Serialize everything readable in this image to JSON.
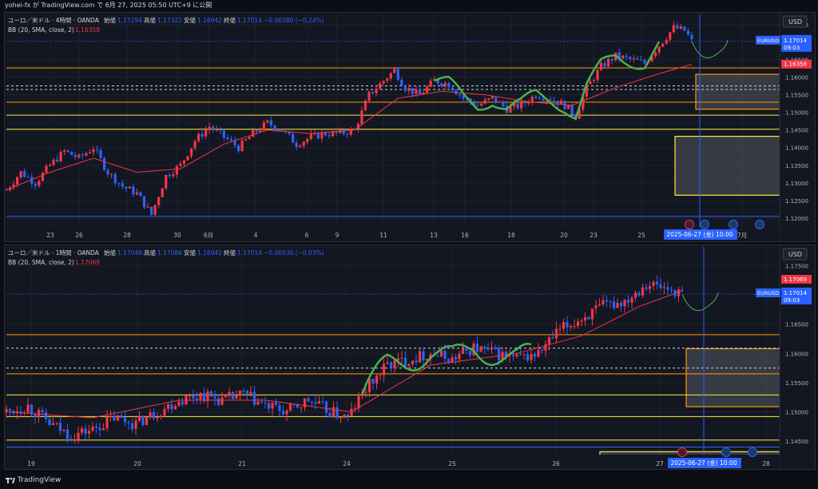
{
  "header": {
    "text": "yohei-fx が TradingView.com で 6月 27, 2025 05:50 UTC+9 に公開"
  },
  "footer": {
    "brand": "TradingView"
  },
  "colors": {
    "bull": "#f23645",
    "bear": "#2962ff",
    "bb": "#f23645",
    "bg": "#131722",
    "grid": "#1e222d",
    "accent": "#2962ff",
    "yellow": "#ffeb3b",
    "orange": "#ff9800"
  },
  "panels": [
    {
      "legend1": "ユーロ／米ドル · 4時間 · OANDA",
      "ohlc_labels": [
        "始値",
        "高値",
        "安値",
        "終値"
      ],
      "ohlc_values": [
        "1.17294",
        "1.17322",
        "1.16942",
        "1.17014"
      ],
      "change": "−0.00280 (−0.24%)",
      "legend2": "BB (20, SMA, close, 2)",
      "bb_value": "1.16358",
      "currency": "USD",
      "symbol": "EURUSD",
      "price_tag": "1.17014",
      "countdown": "09:03",
      "bb_tag": "1.16358",
      "date_tag": "2025-06-27 (金)  10:00",
      "x_labels": [
        "23",
        "26",
        "28",
        "30",
        "6月",
        "4",
        "6",
        "9",
        "11",
        "13",
        "16",
        "18",
        "20",
        "23",
        "25",
        "7月"
      ],
      "y_labels": [
        "1.17500",
        "1.16500",
        "1.16000",
        "1.15500",
        "1.15000",
        "1.14500",
        "1.14000",
        "1.13500",
        "1.13000",
        "1.12500",
        "1.12000"
      ]
    },
    {
      "legend1": "ユーロ／米ドル · 1時間 · OANDA",
      "ohlc_labels": [
        "始値",
        "高値",
        "安値",
        "終値"
      ],
      "ohlc_values": [
        "1.17046",
        "1.17086",
        "1.16942",
        "1.17014"
      ],
      "change": "−0.00030 (−0.03%)",
      "legend2": "BB (20, SMA, close, 2)",
      "bb_value": "1.17069",
      "currency": "USD",
      "symbol": "EURUSD",
      "price_tag": "1.17014",
      "countdown": "09:03",
      "bb_tag": "1.17069",
      "date_tag": "2025-06-27 (金)  10:00",
      "x_labels": [
        "19",
        "20",
        "21",
        "24",
        "25",
        "26",
        "27",
        "28"
      ],
      "y_labels": [
        "1.17500",
        "1.16500",
        "1.16000",
        "1.15500",
        "1.15000",
        "1.14500"
      ]
    }
  ],
  "chart_data": [
    {
      "type": "candlestick",
      "title": "ユーロ／米ドル · 4時間 · OANDA",
      "y_range": [
        1.1175,
        1.1778
      ],
      "x_ticks": [
        "23",
        "26",
        "28",
        "30",
        "6月",
        "4",
        "6",
        "9",
        "11",
        "13",
        "16",
        "18",
        "20",
        "23",
        "25",
        "7月"
      ],
      "y_ticks": [
        1.175,
        1.165,
        1.16,
        1.155,
        1.15,
        1.145,
        1.14,
        1.135,
        1.13,
        1.125,
        1.12
      ],
      "path_points": [
        [
          0,
          1.128
        ],
        [
          4,
          1.133
        ],
        [
          8,
          1.13
        ],
        [
          12,
          1.135
        ],
        [
          16,
          1.139
        ],
        [
          20,
          1.137
        ],
        [
          24,
          1.14
        ],
        [
          28,
          1.133
        ],
        [
          32,
          1.129
        ],
        [
          36,
          1.127
        ],
        [
          40,
          1.121
        ],
        [
          44,
          1.132
        ],
        [
          48,
          1.135
        ],
        [
          52,
          1.142
        ],
        [
          56,
          1.146
        ],
        [
          60,
          1.143
        ],
        [
          64,
          1.14
        ],
        [
          68,
          1.144
        ],
        [
          72,
          1.147
        ],
        [
          76,
          1.145
        ],
        [
          80,
          1.141
        ],
        [
          84,
          1.143
        ],
        [
          88,
          1.144
        ],
        [
          92,
          1.144
        ],
        [
          96,
          1.145
        ],
        [
          100,
          1.155
        ],
        [
          104,
          1.159
        ],
        [
          107,
          1.162
        ],
        [
          110,
          1.157
        ],
        [
          114,
          1.155
        ],
        [
          118,
          1.159
        ],
        [
          122,
          1.158
        ],
        [
          126,
          1.154
        ],
        [
          130,
          1.152
        ],
        [
          134,
          1.154
        ],
        [
          138,
          1.151
        ],
        [
          142,
          1.152
        ],
        [
          146,
          1.155
        ],
        [
          150,
          1.154
        ],
        [
          154,
          1.152
        ],
        [
          157,
          1.149
        ],
        [
          160,
          1.157
        ],
        [
          164,
          1.163
        ],
        [
          168,
          1.166
        ],
        [
          172,
          1.165
        ],
        [
          176,
          1.164
        ],
        [
          180,
          1.169
        ],
        [
          184,
          1.174
        ],
        [
          187,
          1.1732
        ],
        [
          189,
          1.1701
        ]
      ],
      "bollinger_mid": [
        [
          0,
          1.128
        ],
        [
          12,
          1.133
        ],
        [
          24,
          1.137
        ],
        [
          36,
          1.133
        ],
        [
          48,
          1.134
        ],
        [
          60,
          1.141
        ],
        [
          72,
          1.145
        ],
        [
          84,
          1.144
        ],
        [
          96,
          1.145
        ],
        [
          108,
          1.154
        ],
        [
          120,
          1.156
        ],
        [
          132,
          1.155
        ],
        [
          144,
          1.153
        ],
        [
          156,
          1.152
        ],
        [
          168,
          1.157
        ],
        [
          180,
          1.161
        ],
        [
          189,
          1.1636
        ]
      ],
      "support_lines": [
        1.1626,
        1.1575,
        1.1565,
        1.1529,
        1.1492,
        1.1452,
        1.1205
      ],
      "boxes": [
        {
          "from": 1.1509,
          "to": 1.1608
        },
        {
          "from": 1.1265,
          "to": 1.1432
        }
      ],
      "last_price": 1.17014,
      "bb_last": 1.16358
    },
    {
      "type": "candlestick",
      "title": "ユーロ／米ドル · 1時間 · OANDA",
      "y_range": [
        1.1427,
        1.1782
      ],
      "x_ticks": [
        "19",
        "20",
        "21",
        "24",
        "25",
        "26",
        "27",
        "28"
      ],
      "y_ticks": [
        1.175,
        1.165,
        1.16,
        1.155,
        1.15,
        1.145
      ],
      "path_points": [
        [
          0,
          1.15
        ],
        [
          6,
          1.151
        ],
        [
          12,
          1.148
        ],
        [
          18,
          1.146
        ],
        [
          24,
          1.147
        ],
        [
          30,
          1.149
        ],
        [
          36,
          1.148
        ],
        [
          42,
          1.15
        ],
        [
          48,
          1.152
        ],
        [
          54,
          1.153
        ],
        [
          60,
          1.152
        ],
        [
          66,
          1.153
        ],
        [
          72,
          1.151
        ],
        [
          78,
          1.15
        ],
        [
          84,
          1.152
        ],
        [
          90,
          1.15
        ],
        [
          95,
          1.149
        ],
        [
          100,
          1.154
        ],
        [
          106,
          1.158
        ],
        [
          112,
          1.159
        ],
        [
          118,
          1.16
        ],
        [
          124,
          1.159
        ],
        [
          130,
          1.161
        ],
        [
          136,
          1.16
        ],
        [
          142,
          1.159
        ],
        [
          148,
          1.16
        ],
        [
          154,
          1.164
        ],
        [
          160,
          1.166
        ],
        [
          166,
          1.168
        ],
        [
          172,
          1.169
        ],
        [
          178,
          1.172
        ],
        [
          184,
          1.171
        ],
        [
          188,
          1.1702
        ]
      ],
      "bollinger_mid": [
        [
          0,
          1.15
        ],
        [
          24,
          1.149
        ],
        [
          48,
          1.152
        ],
        [
          72,
          1.152
        ],
        [
          96,
          1.15
        ],
        [
          118,
          1.158
        ],
        [
          142,
          1.16
        ],
        [
          160,
          1.163
        ],
        [
          176,
          1.168
        ],
        [
          188,
          1.1707
        ]
      ],
      "support_lines": [
        1.1632,
        1.1609,
        1.1575,
        1.1565,
        1.1529,
        1.1492,
        1.1452,
        1.144
      ],
      "boxes": [
        {
          "from": 1.1509,
          "to": 1.1608
        },
        {
          "from": 1.1432,
          "to": 1.1399
        }
      ],
      "last_price": 1.17014,
      "bb_last": 1.17069
    }
  ]
}
